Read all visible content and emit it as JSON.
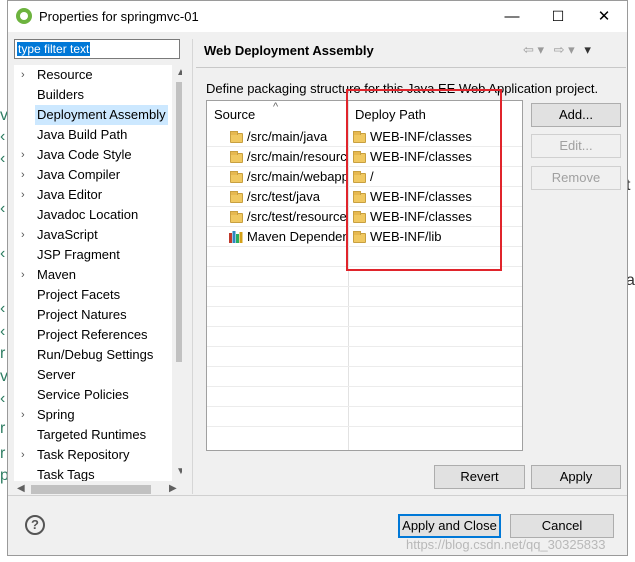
{
  "window": {
    "title": "Properties for springmvc-01",
    "minimize_glyph": "—",
    "maximize_glyph": "☐",
    "close_glyph": "✕"
  },
  "filter": {
    "value": "type filter text"
  },
  "tree": {
    "items": [
      {
        "label": "Resource",
        "expandable": true
      },
      {
        "label": "Builders",
        "expandable": false
      },
      {
        "label": "Deployment Assembly",
        "expandable": false,
        "selected": true
      },
      {
        "label": "Java Build Path",
        "expandable": false
      },
      {
        "label": "Java Code Style",
        "expandable": true
      },
      {
        "label": "Java Compiler",
        "expandable": true
      },
      {
        "label": "Java Editor",
        "expandable": true
      },
      {
        "label": "Javadoc Location",
        "expandable": false
      },
      {
        "label": "JavaScript",
        "expandable": true
      },
      {
        "label": "JSP Fragment",
        "expandable": false
      },
      {
        "label": "Maven",
        "expandable": true
      },
      {
        "label": "Project Facets",
        "expandable": false
      },
      {
        "label": "Project Natures",
        "expandable": false
      },
      {
        "label": "Project References",
        "expandable": false
      },
      {
        "label": "Run/Debug Settings",
        "expandable": false
      },
      {
        "label": "Server",
        "expandable": false
      },
      {
        "label": "Service Policies",
        "expandable": false
      },
      {
        "label": "Spring",
        "expandable": true
      },
      {
        "label": "Targeted Runtimes",
        "expandable": false
      },
      {
        "label": "Task Repository",
        "expandable": true
      },
      {
        "label": "Task Tags",
        "expandable": false
      }
    ]
  },
  "page": {
    "title": "Web Deployment Assembly",
    "description": "Define packaging structure for this Java EE Web Application project.",
    "nav_back": "⇦ ▾",
    "nav_forward": "⇨ ▾",
    "menu_glyph": "▾"
  },
  "table": {
    "col_source": "Source",
    "col_deploy": "Deploy Path",
    "sort_glyph": "^",
    "rows": [
      {
        "source": "/src/main/java",
        "deploy": "WEB-INF/classes",
        "icon": "folder-icon"
      },
      {
        "source": "/src/main/resources",
        "deploy": "WEB-INF/classes",
        "icon": "folder-icon"
      },
      {
        "source": "/src/main/webapp",
        "deploy": "/",
        "icon": "folder-icon"
      },
      {
        "source": "/src/test/java",
        "deploy": "WEB-INF/classes",
        "icon": "folder-icon"
      },
      {
        "source": "/src/test/resources",
        "deploy": "WEB-INF/classes",
        "icon": "folder-icon"
      },
      {
        "source": "Maven Dependencies",
        "deploy": "WEB-INF/lib",
        "icon": "library-icon"
      }
    ]
  },
  "buttons": {
    "add": "Add...",
    "edit": "Edit...",
    "remove": "Remove",
    "revert": "Revert",
    "apply": "Apply",
    "apply_close": "Apply and Close",
    "cancel": "Cancel",
    "help": "?"
  },
  "watermark": "https://blog.csdn.net/qq_30325833",
  "colors": {
    "accent": "#0078d7",
    "highlight": "#e0242b",
    "selection": "#cce8ff"
  }
}
